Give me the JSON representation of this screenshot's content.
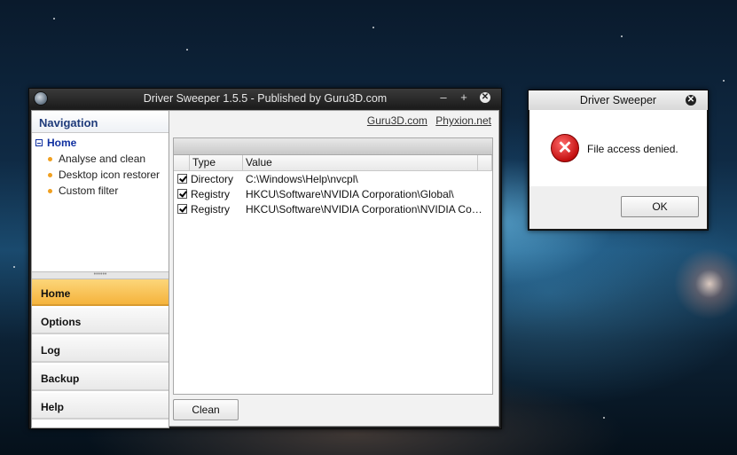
{
  "main_window": {
    "title": "Driver Sweeper 1.5.5 - Published by Guru3D.com",
    "minimize_glyph": "–",
    "maximize_glyph": "+",
    "close_glyph": "✕"
  },
  "navigation": {
    "header": "Navigation",
    "tree_root": "Home",
    "tree_items": [
      "Analyse and clean",
      "Desktop icon restorer",
      "Custom filter"
    ],
    "grip": "••••••",
    "buttons": [
      "Home",
      "Options",
      "Log",
      "Backup",
      "Help"
    ],
    "active_button": "Home"
  },
  "content": {
    "links": [
      "Guru3D.com",
      "Phyxion.net"
    ],
    "columns": [
      "Type",
      "Value"
    ],
    "rows": [
      {
        "checked": true,
        "type": "Directory",
        "value": "C:\\Windows\\Help\\nvcpl\\"
      },
      {
        "checked": true,
        "type": "Registry",
        "value": "HKCU\\Software\\NVIDIA Corporation\\Global\\"
      },
      {
        "checked": true,
        "type": "Registry",
        "value": "HKCU\\Software\\NVIDIA Corporation\\NVIDIA Contro..."
      }
    ],
    "clean_button": "Clean"
  },
  "dialog": {
    "title": "Driver Sweeper",
    "close_glyph": "✕",
    "icon": "error-icon",
    "message": "File access denied.",
    "ok_button": "OK"
  },
  "colors": {
    "active_nav": "#f5b33c",
    "nav_header_text": "#1f3b7a",
    "error_red": "#c41010",
    "bullet_orange": "#f0a020"
  }
}
